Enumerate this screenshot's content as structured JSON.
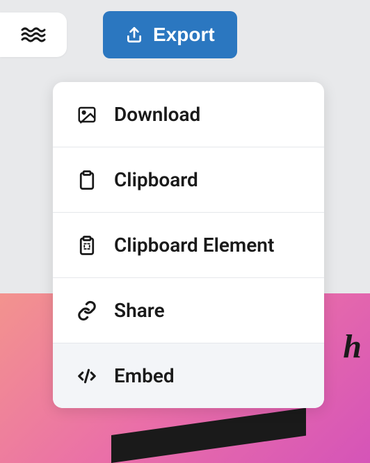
{
  "toolbar": {
    "export_label": "Export"
  },
  "menu": {
    "items": [
      {
        "label": "Download"
      },
      {
        "label": "Clipboard"
      },
      {
        "label": "Clipboard Element"
      },
      {
        "label": "Share"
      },
      {
        "label": "Embed"
      }
    ]
  },
  "bg_text": "h"
}
